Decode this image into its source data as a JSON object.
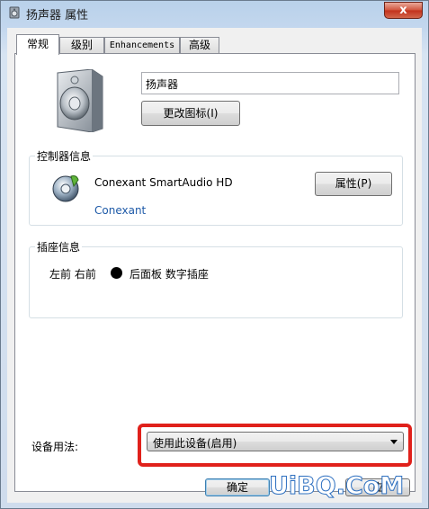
{
  "window": {
    "title": "扬声器 属性",
    "close_glyph": "x"
  },
  "tabs": [
    {
      "label": "常规",
      "active": true
    },
    {
      "label": "级别",
      "active": false
    },
    {
      "label": "Enhancements",
      "active": false
    },
    {
      "label": "高级",
      "active": false
    }
  ],
  "general": {
    "device_name_value": "扬声器",
    "change_icon_button": "更改图标(I)",
    "controller_group_title": "控制器信息",
    "controller_name": "Conexant SmartAudio HD",
    "controller_vendor": "Conexant",
    "properties_button": "属性(P)",
    "jack_group_title": "插座信息",
    "jack_left_text": "左前 右前",
    "jack_right_text": "后面板 数字插座",
    "device_usage_label": "设备用法:",
    "device_usage_value": "使用此设备(启用)"
  },
  "footer": {
    "ok_button": "确定",
    "apply_button_partial": "应"
  },
  "watermark": "UiBQ.CoM",
  "colors": {
    "highlight_border": "#e0211b",
    "close_button": "#c2301b",
    "vendor_link": "#1e5aa8",
    "watermark_stroke": "#2d6fc0"
  }
}
